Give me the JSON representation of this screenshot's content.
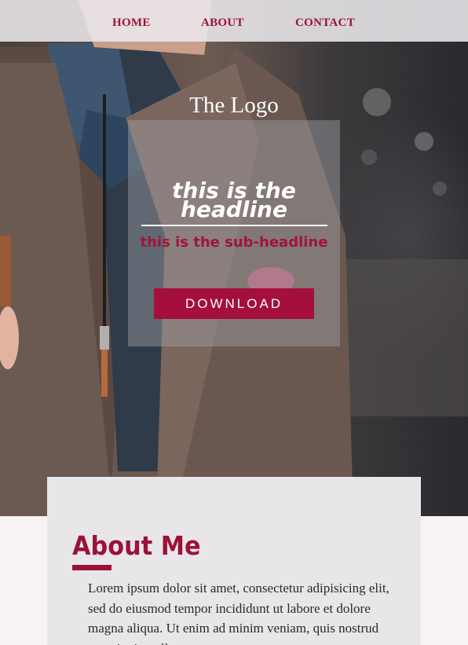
{
  "nav": {
    "items": [
      {
        "label": "HOME"
      },
      {
        "label": "ABOUT"
      },
      {
        "label": "CONTACT"
      }
    ]
  },
  "hero": {
    "logo": "The Logo",
    "headline": "this is the headline",
    "subheadline": "this is the sub-headline",
    "cta_label": "DOWNLOAD"
  },
  "about": {
    "title": "About Me",
    "body": "Lorem ipsum dolor sit amet, consectetur adipisicing elit, sed do eiusmod tempor incididunt ut labore et dolore magna aliqua. Ut enim ad minim veniam, quis nostrud exercitation ullamco"
  },
  "colors": {
    "accent": "#9b1238",
    "button": "#a50f3c",
    "nav_background": "#ebe8ec",
    "about_background": "#e8e6e8"
  },
  "images": {
    "hero_background": "man-in-tweed-jacket-photo"
  }
}
